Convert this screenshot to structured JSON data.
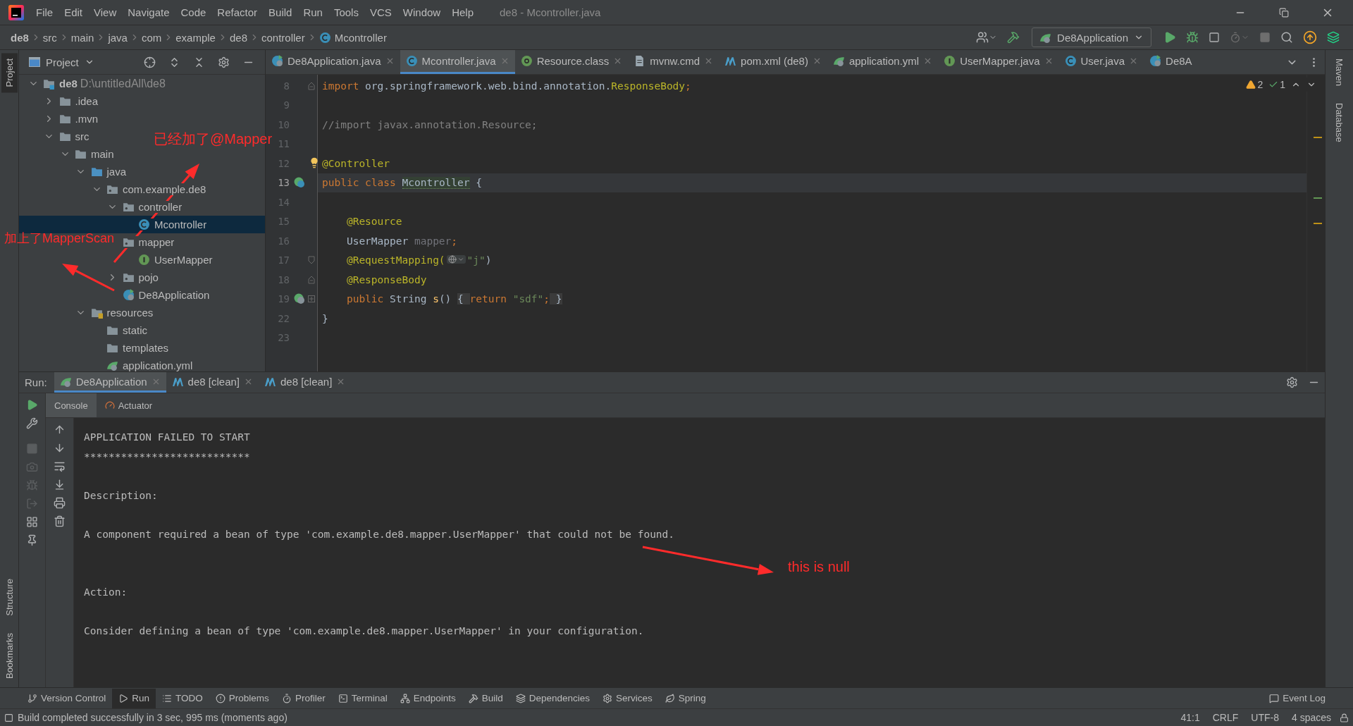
{
  "window": {
    "title": "de8 - Mcontroller.java",
    "menu": [
      "File",
      "Edit",
      "View",
      "Navigate",
      "Code",
      "Refactor",
      "Build",
      "Run",
      "Tools",
      "VCS",
      "Window",
      "Help"
    ]
  },
  "breadcrumb": [
    "de8",
    "src",
    "main",
    "java",
    "com",
    "example",
    "de8",
    "controller",
    "Mcontroller"
  ],
  "run_config": "De8Application",
  "left_strip_top": [
    {
      "label": "Project",
      "selected": true
    }
  ],
  "left_strip_bottom": [
    {
      "label": "Structure",
      "selected": false
    },
    {
      "label": "Bookmarks",
      "selected": false
    }
  ],
  "right_strip": [
    "Maven",
    "Database"
  ],
  "project_panel": {
    "title": "Project",
    "tree": [
      {
        "label": "de8",
        "path": "D:\\untitledAll\\de8",
        "kind": "module",
        "expanded": true,
        "selected": false,
        "children": [
          {
            "label": ".idea",
            "kind": "folder",
            "expanded": false,
            "selected": false
          },
          {
            "label": ".mvn",
            "kind": "folder",
            "expanded": false,
            "selected": false
          },
          {
            "label": "src",
            "kind": "folder",
            "expanded": true,
            "selected": false,
            "children": [
              {
                "label": "main",
                "kind": "folder",
                "expanded": true,
                "selected": false,
                "children": [
                  {
                    "label": "java",
                    "kind": "source",
                    "expanded": true,
                    "selected": false,
                    "children": [
                      {
                        "label": "com.example.de8",
                        "kind": "package",
                        "expanded": true,
                        "selected": false,
                        "children": [
                          {
                            "label": "controller",
                            "kind": "package",
                            "expanded": true,
                            "selected": false,
                            "children": [
                              {
                                "label": "Mcontroller",
                                "kind": "class",
                                "selected": true
                              }
                            ]
                          },
                          {
                            "label": "mapper",
                            "kind": "package",
                            "selected": false,
                            "children": [
                              {
                                "label": "UserMapper",
                                "kind": "interface",
                                "selected": false
                              }
                            ]
                          },
                          {
                            "label": "pojo",
                            "kind": "package",
                            "expanded": false,
                            "selected": false
                          },
                          {
                            "label": "De8Application",
                            "kind": "spring",
                            "selected": false
                          }
                        ]
                      }
                    ]
                  },
                  {
                    "label": "resources",
                    "kind": "resources",
                    "expanded": true,
                    "selected": false,
                    "children": [
                      {
                        "label": "static",
                        "kind": "folder",
                        "selected": false
                      },
                      {
                        "label": "templates",
                        "kind": "folder",
                        "selected": false
                      },
                      {
                        "label": "application.yml",
                        "kind": "yml",
                        "selected": false
                      }
                    ]
                  }
                ]
              }
            ]
          }
        ]
      }
    ]
  },
  "editor_tabs": [
    {
      "label": "De8Application.java",
      "kind": "spring",
      "selected": false
    },
    {
      "label": "Mcontroller.java",
      "kind": "class",
      "selected": true
    },
    {
      "label": "Resource.class",
      "kind": "annotation",
      "selected": false
    },
    {
      "label": "mvnw.cmd",
      "kind": "file",
      "selected": false
    },
    {
      "label": "pom.xml (de8)",
      "kind": "maven",
      "selected": false
    },
    {
      "label": "application.yml",
      "kind": "yml",
      "selected": false
    },
    {
      "label": "UserMapper.java",
      "kind": "interface",
      "selected": false
    },
    {
      "label": "User.java",
      "kind": "class",
      "selected": false
    },
    {
      "label": "De8A",
      "kind": "spring",
      "selected": false
    }
  ],
  "inspections": {
    "warnings": "2",
    "passed": "1"
  },
  "code": [
    {
      "number": "8",
      "fold": {
        "kind": "end"
      },
      "tokens": [
        {
          "text": "import ",
          "kind": "keyword"
        },
        {
          "text": "org.springframework.web.bind.annotation.",
          "kind": "plain"
        },
        {
          "text": "ResponseBody",
          "kind": "annotation"
        },
        {
          "text": ";",
          "kind": "keyword"
        }
      ]
    },
    {
      "number": "9"
    },
    {
      "number": "10",
      "tokens": [
        {
          "text": "//import javax.annotation.Resource;",
          "kind": "comment"
        }
      ]
    },
    {
      "number": "11"
    },
    {
      "number": "12",
      "bulb": true,
      "tokens": [
        {
          "text": "@Controller",
          "kind": "annotation"
        }
      ]
    },
    {
      "number": "13",
      "current": true,
      "gutter": {
        "kind": "bean"
      },
      "tokens": [
        {
          "text": "public class ",
          "kind": "keyword"
        },
        {
          "text": "Mcontroller",
          "kind": "declaration"
        },
        {
          "text": " {",
          "kind": "plain"
        }
      ]
    },
    {
      "number": "14"
    },
    {
      "number": "15",
      "tokens": [
        {
          "text": "    @Resource",
          "kind": "annotation"
        }
      ]
    },
    {
      "number": "16",
      "tokens": [
        {
          "text": "    UserMapper ",
          "kind": "plain"
        },
        {
          "text": "mapper",
          "kind": "unused"
        },
        {
          "text": ";",
          "kind": "keyword"
        }
      ]
    },
    {
      "number": "17",
      "fold": {
        "kind": "start"
      },
      "tokens": [
        {
          "text": "    @RequestMapping(",
          "kind": "annotation"
        },
        {
          "kind": "inlay"
        },
        {
          "text": "\"j\"",
          "kind": "string"
        },
        {
          "text": ")",
          "kind": "plain"
        }
      ]
    },
    {
      "number": "18",
      "fold": {
        "kind": "end"
      },
      "tokens": [
        {
          "text": "    @ResponseBody",
          "kind": "annotation"
        }
      ]
    },
    {
      "number": "19",
      "gutter": {
        "kind": "web"
      },
      "fold": {
        "kind": "collapsed"
      },
      "tokens": [
        {
          "text": "    public ",
          "kind": "keyword"
        },
        {
          "text": "String ",
          "kind": "plain"
        },
        {
          "text": "s",
          "kind": "fn"
        },
        {
          "text": "() ",
          "kind": "plain"
        },
        {
          "text": "{ ",
          "kind": "fold"
        },
        {
          "text": "return ",
          "kind": "keyword"
        },
        {
          "text": "\"sdf\"",
          "kind": "string"
        },
        {
          "text": ";",
          "kind": "keyword"
        },
        {
          "text": " }",
          "kind": "fold"
        }
      ]
    },
    {
      "number": "22",
      "tokens": [
        {
          "text": "}",
          "kind": "plain"
        }
      ]
    },
    {
      "number": "23"
    }
  ],
  "run_panel": {
    "label": "Run:",
    "tabs": [
      {
        "label": "De8Application",
        "kind": "spring",
        "selected": true
      },
      {
        "label": "de8 [clean]",
        "kind": "maven",
        "selected": false
      },
      {
        "label": "de8 [clean]",
        "kind": "maven",
        "selected": false
      }
    ],
    "subtabs": [
      {
        "label": "Console",
        "selected": true
      },
      {
        "label": "Actuator",
        "kind": "actuator",
        "selected": false
      }
    ],
    "console": [
      {
        "text": "APPLICATION FAILED TO START",
        "kind": "line"
      },
      {
        "text": "***************************",
        "kind": "line"
      },
      {
        "text": "Description:",
        "kind": "para"
      },
      {
        "text": "A component required a bean of type 'com.example.de8.mapper.UserMapper' that could not be found.",
        "kind": "para"
      },
      {
        "text": "Action:",
        "kind": "section"
      },
      {
        "text": "Consider defining a bean of type 'com.example.de8.mapper.UserMapper' in your configuration.",
        "kind": "para"
      }
    ]
  },
  "tool_windows": [
    {
      "label": "Version Control",
      "kind": "vcs",
      "selected": false
    },
    {
      "label": "Run",
      "kind": "run",
      "selected": true
    },
    {
      "label": "TODO",
      "kind": "todo",
      "selected": false
    },
    {
      "label": "Problems",
      "kind": "problems",
      "selected": false
    },
    {
      "label": "Profiler",
      "kind": "profiler",
      "selected": false
    },
    {
      "label": "Terminal",
      "kind": "terminal",
      "selected": false
    },
    {
      "label": "Endpoints",
      "kind": "endpoints",
      "selected": false
    },
    {
      "label": "Build",
      "kind": "build",
      "selected": false
    },
    {
      "label": "Dependencies",
      "kind": "dependencies",
      "selected": false
    },
    {
      "label": "Services",
      "kind": "services",
      "selected": false
    },
    {
      "label": "Spring",
      "kind": "spring",
      "selected": false
    }
  ],
  "event_log": "Event Log",
  "status": {
    "message": "Build completed successfully in 3 sec, 995 ms (moments ago)",
    "items": [
      "41:1",
      "CRLF",
      "UTF-8",
      "4 spaces"
    ]
  },
  "annotations": [
    "已经加了@Mapper",
    "加上了MapperScan",
    "this  is null"
  ]
}
